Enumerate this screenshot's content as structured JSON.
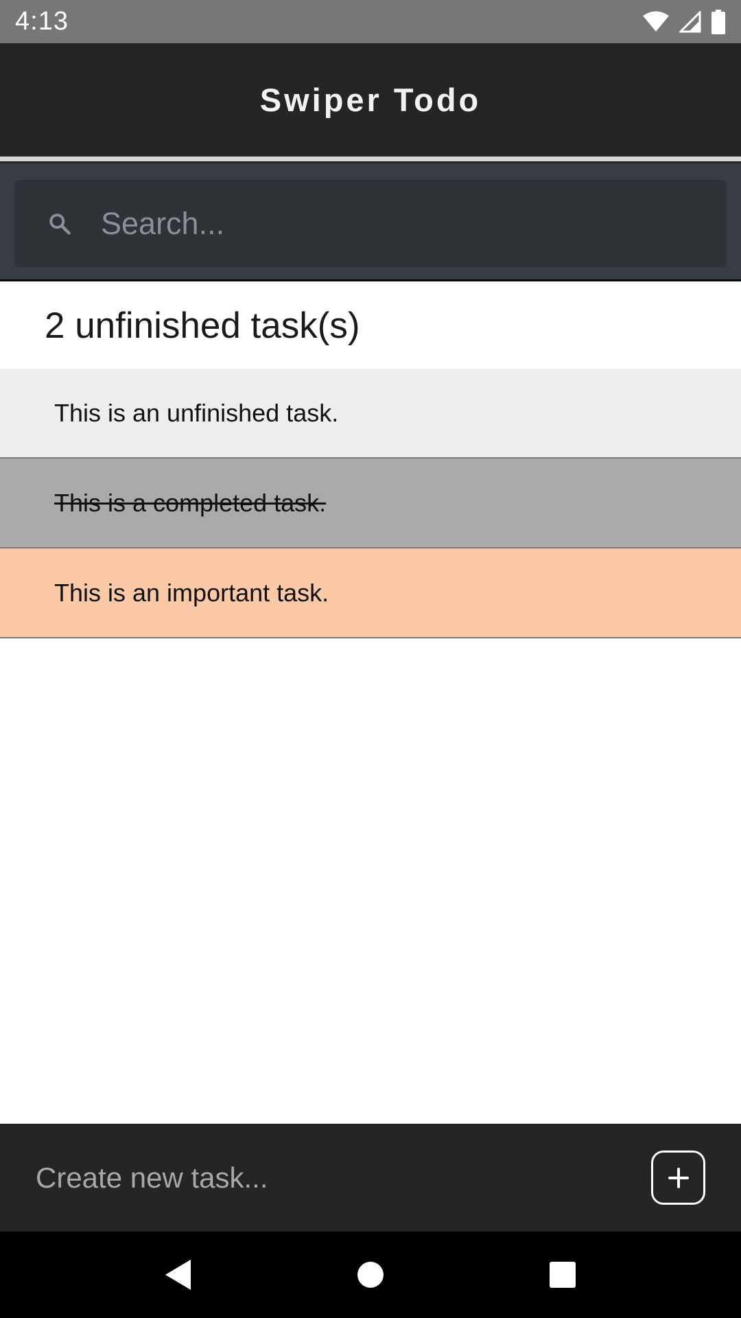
{
  "status_bar": {
    "time": "4:13",
    "icons": [
      "wifi-icon",
      "signal-icon",
      "battery-icon"
    ]
  },
  "app": {
    "title": "Swiper Todo"
  },
  "search": {
    "placeholder": "Search...",
    "value": ""
  },
  "summary": {
    "text": "2 unfinished task(s)"
  },
  "tasks": [
    {
      "text": "This is an unfinished task.",
      "state": "unfinished",
      "color": "#eeeeee"
    },
    {
      "text": "This is a completed task.",
      "state": "completed",
      "color": "#aaaaaa"
    },
    {
      "text": "This is an important task.",
      "state": "important",
      "color": "#fcc9a6"
    }
  ],
  "create": {
    "placeholder": "Create new task...",
    "value": "",
    "add_icon": "plus-icon"
  },
  "nav": {
    "icons": [
      "back-icon",
      "home-icon",
      "recents-icon"
    ]
  },
  "colors": {
    "status_bar": "#777777",
    "header": "#252525",
    "search_bg": "#383d45",
    "search_box": "#2f3237",
    "nav_bar": "#000000"
  }
}
